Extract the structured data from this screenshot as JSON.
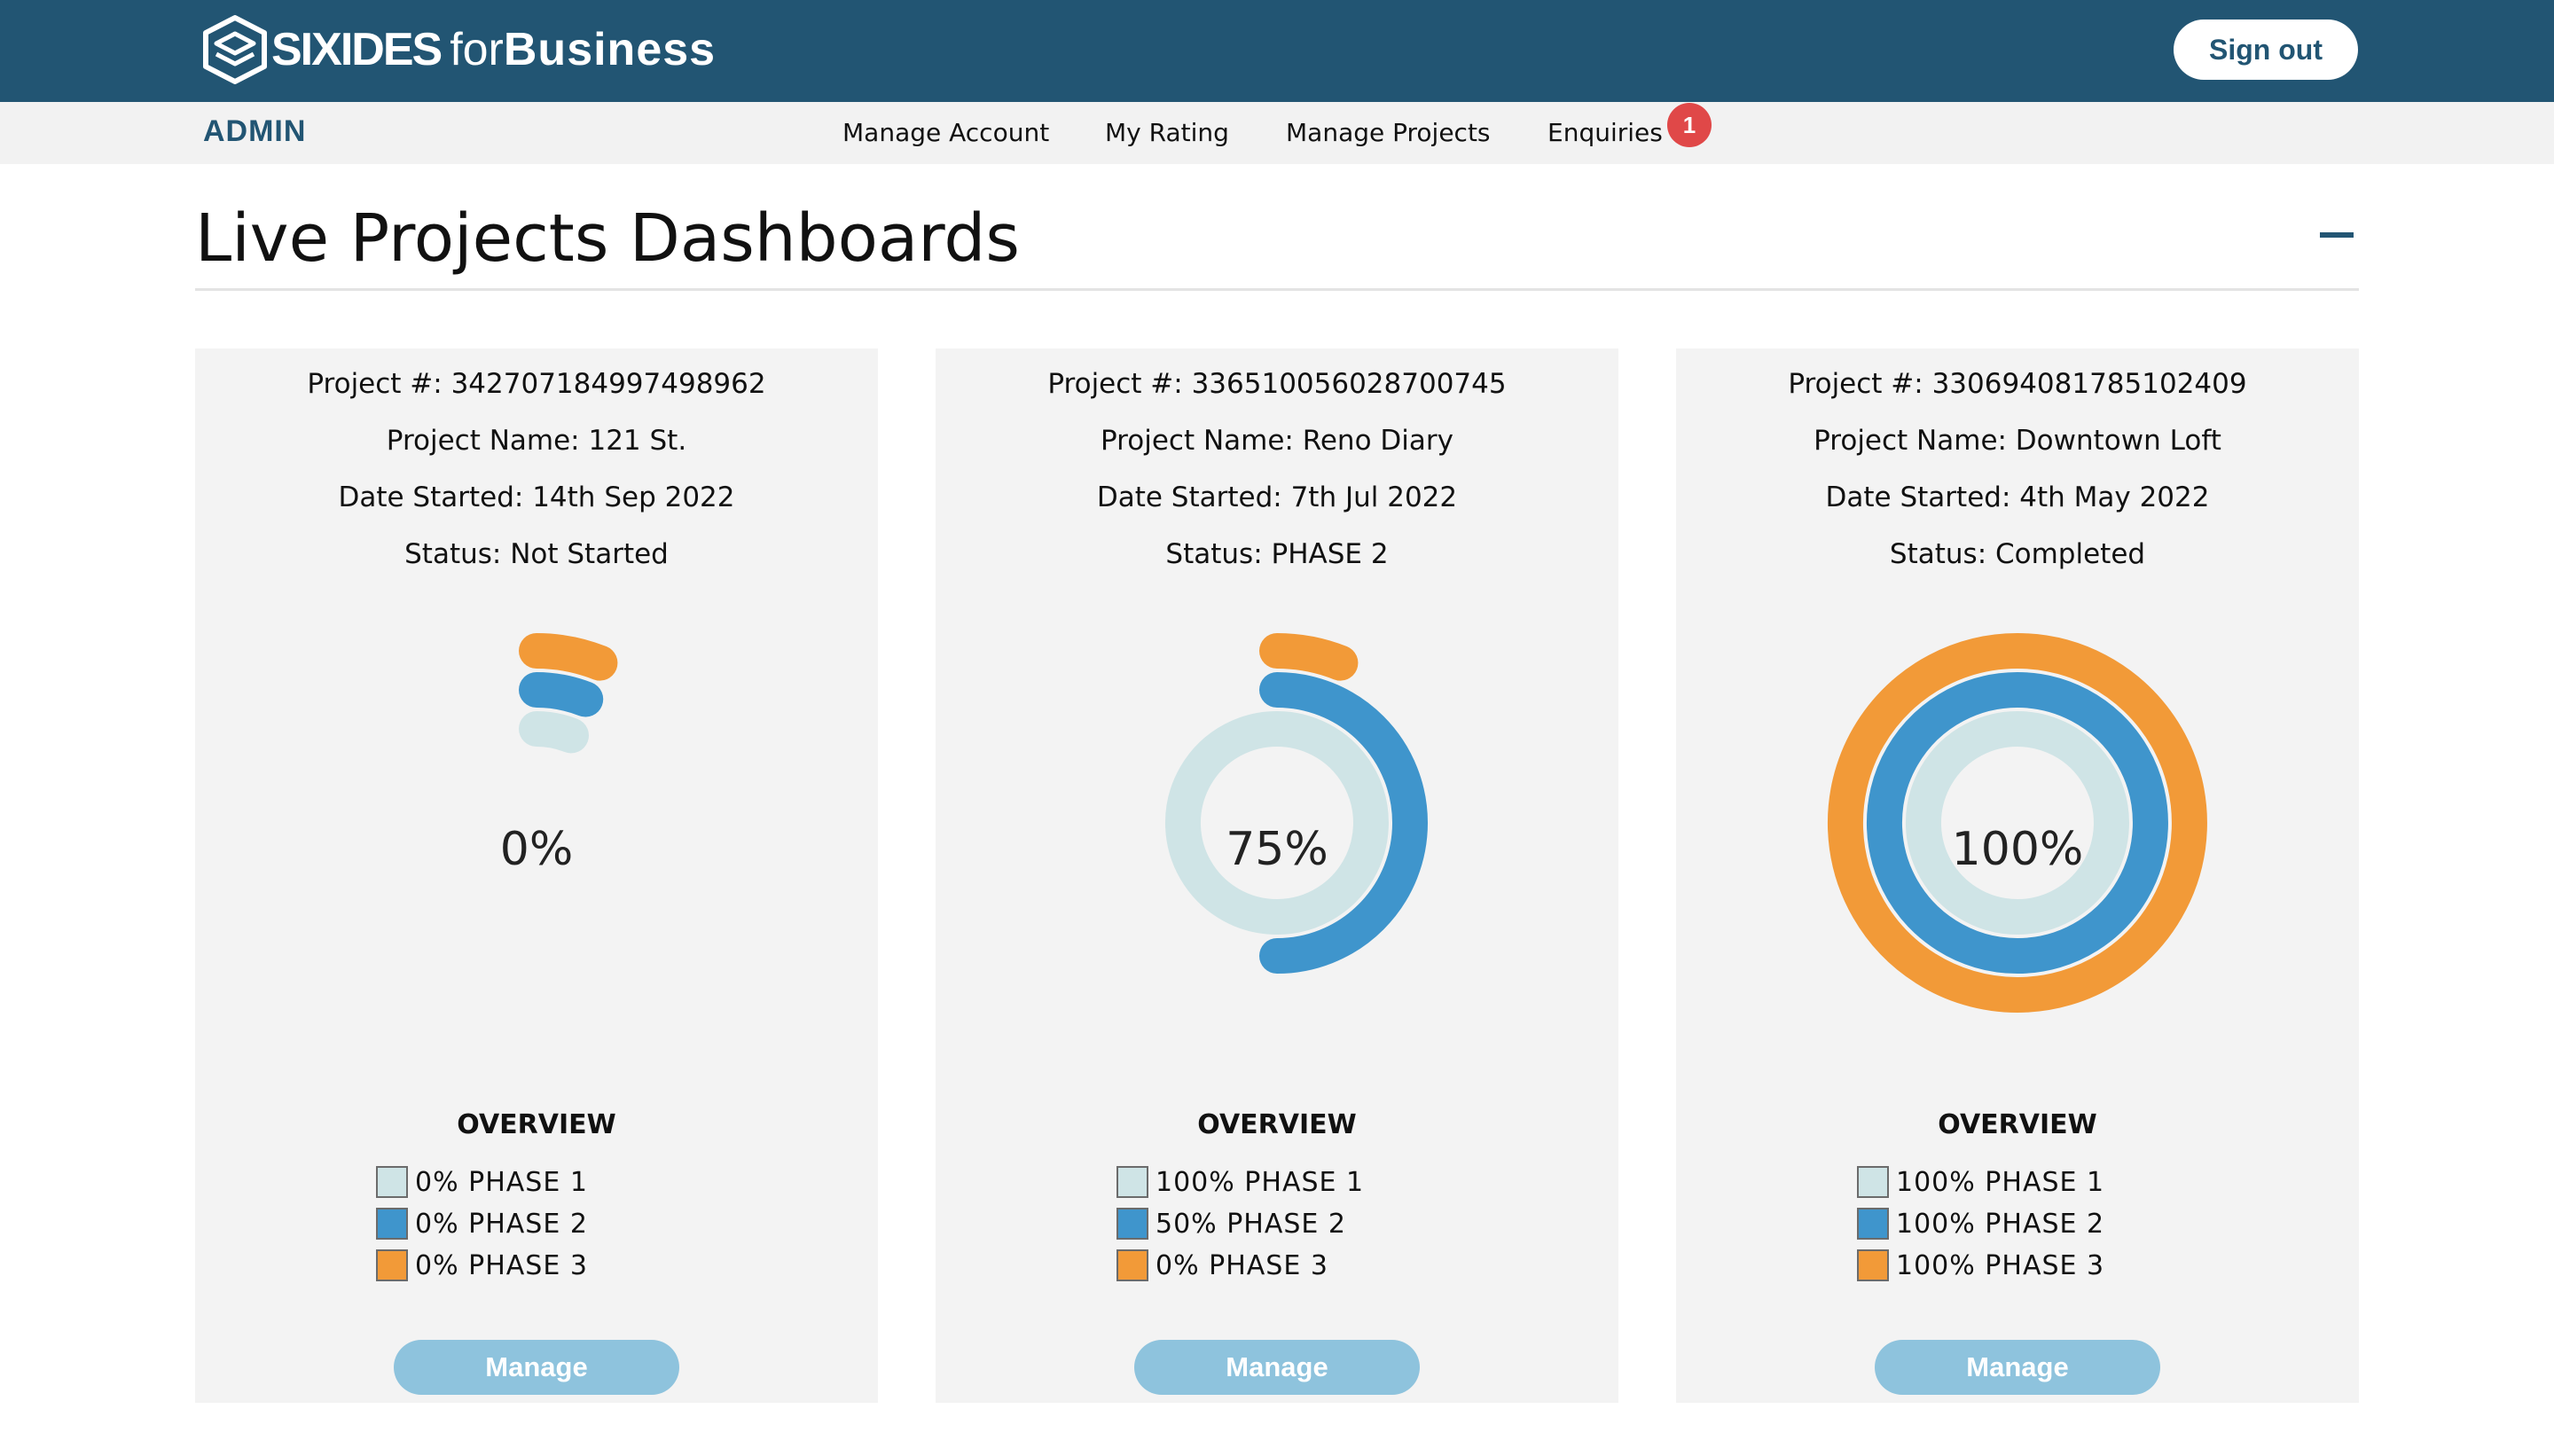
{
  "header": {
    "brand": "SIXIDES",
    "brand_for": "for",
    "brand_business": "Business",
    "signout_label": "Sign out"
  },
  "nav": {
    "role": "ADMIN",
    "links": [
      {
        "label": "Manage Account"
      },
      {
        "label": "My Rating"
      },
      {
        "label": "Manage Projects"
      },
      {
        "label": "Enquiries"
      }
    ],
    "enquiries_badge": "1"
  },
  "section": {
    "title": "Live Projects Dashboards"
  },
  "colors": {
    "phase1": "#cfe4e6",
    "phase2": "#3f95cc",
    "phase3": "#f29a38",
    "header_bg": "#225573"
  },
  "cards": [
    {
      "project_number": "Project #: 342707184997498962",
      "project_name": "Project Name: 121 St.",
      "date_started": "Date Started: 14th Sep 2022",
      "status": "Status: Not Started",
      "percent": "0%",
      "overview_label": "OVERVIEW",
      "legend": [
        "0% PHASE 1",
        "0% PHASE 2",
        "0% PHASE 3"
      ],
      "manage_label": "Manage"
    },
    {
      "project_number": "Project #: 336510056028700745",
      "project_name": "Project Name: Reno Diary",
      "date_started": "Date Started: 7th Jul 2022",
      "status": "Status: PHASE 2",
      "percent": "75%",
      "overview_label": "OVERVIEW",
      "legend": [
        "100% PHASE 1",
        "50% PHASE 2",
        "0% PHASE 3"
      ],
      "manage_label": "Manage"
    },
    {
      "project_number": "Project #: 330694081785102409",
      "project_name": "Project Name: Downtown Loft",
      "date_started": "Date Started: 4th May 2022",
      "status": "Status: Completed",
      "percent": "100%",
      "overview_label": "OVERVIEW",
      "legend": [
        "100% PHASE 1",
        "100% PHASE 2",
        "100% PHASE 3"
      ],
      "manage_label": "Manage"
    }
  ],
  "chart_data": [
    {
      "type": "radial-bar",
      "categories": [
        "PHASE 1",
        "PHASE 2",
        "PHASE 3"
      ],
      "values": [
        0,
        0,
        0
      ],
      "center_label": "0%"
    },
    {
      "type": "radial-bar",
      "categories": [
        "PHASE 1",
        "PHASE 2",
        "PHASE 3"
      ],
      "values": [
        100,
        50,
        0
      ],
      "center_label": "75%"
    },
    {
      "type": "radial-bar",
      "categories": [
        "PHASE 1",
        "PHASE 2",
        "PHASE 3"
      ],
      "values": [
        100,
        100,
        100
      ],
      "center_label": "100%"
    }
  ]
}
